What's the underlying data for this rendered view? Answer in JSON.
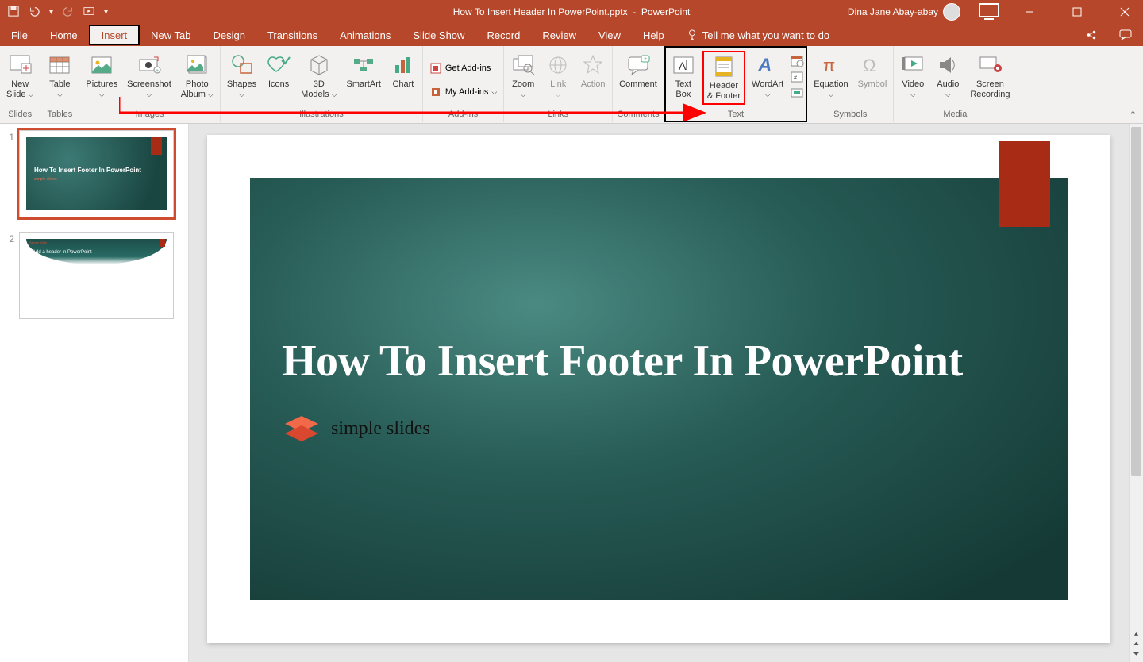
{
  "window": {
    "filename": "How To Insert Header In PowerPoint.pptx",
    "app": "PowerPoint",
    "user": "Dina Jane Abay-abay"
  },
  "tabs": {
    "file": "File",
    "home": "Home",
    "insert": "Insert",
    "newtab": "New Tab",
    "design": "Design",
    "trans": "Transitions",
    "anim": "Animations",
    "slideshow": "Slide Show",
    "record": "Record",
    "review": "Review",
    "view": "View",
    "help": "Help",
    "tellme": "Tell me what you want to do",
    "share": "Share",
    "comments": "Comments"
  },
  "ribbon": {
    "slides": {
      "newslide": "New\nSlide",
      "label": "Slides"
    },
    "tables": {
      "table": "Table",
      "label": "Tables"
    },
    "images": {
      "pictures": "Pictures",
      "screenshot": "Screenshot",
      "album": "Photo\nAlbum",
      "label": "Images"
    },
    "illus": {
      "shapes": "Shapes",
      "icons": "Icons",
      "models": "3D\nModels",
      "smartart": "SmartArt",
      "chart": "Chart",
      "label": "Illustrations"
    },
    "addins": {
      "get": "Get Add-ins",
      "my": "My Add-ins",
      "label": "Add-ins"
    },
    "links": {
      "zoom": "Zoom",
      "link": "Link",
      "action": "Action",
      "label": "Links"
    },
    "comments": {
      "comment": "Comment",
      "label": "Comments"
    },
    "text": {
      "textbox": "Text\nBox",
      "hf": "Header\n& Footer",
      "wordart": "WordArt",
      "label": "Text"
    },
    "symbols": {
      "eq": "Equation",
      "sym": "Symbol",
      "label": "Symbols"
    },
    "media": {
      "video": "Video",
      "audio": "Audio",
      "screen": "Screen\nRecording",
      "label": "Media"
    }
  },
  "thumbs": {
    "n1": "1",
    "n2": "2",
    "s1": "How To Insert Footer In PowerPoint",
    "s1b": "simple slides",
    "s2t": "Simple Slide",
    "s2s": "Add a header in PowerPoint"
  },
  "slide": {
    "title": "How To Insert Footer In PowerPoint",
    "brand": "simple slides"
  }
}
